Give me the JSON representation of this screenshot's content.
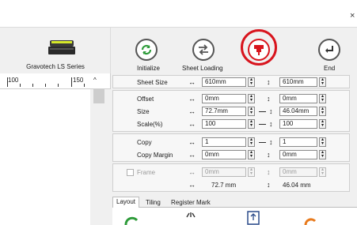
{
  "window": {
    "close_glyph": "×"
  },
  "device": {
    "name": "Gravotech LS Series"
  },
  "toolbar": {
    "initialize": "Initialize",
    "sheet_loading": "Sheet Loading",
    "output": "",
    "end": "End",
    "highlight_color": "#d8141d",
    "initialize_icon_color": "#2e9b3a",
    "output_icon_color": "#d8141d"
  },
  "ruler": {
    "label_100": "100",
    "label_150": "150",
    "caret": "^"
  },
  "fields": {
    "sheet_size": {
      "label": "Sheet Size",
      "width": "610mm",
      "height": "610mm"
    },
    "offset": {
      "label": "Offset",
      "x": "0mm",
      "y": "0mm"
    },
    "size": {
      "label": "Size",
      "width": "72.7mm",
      "height": "46.04mm"
    },
    "scale": {
      "label": "Scale(%)",
      "width": "100",
      "height": "100"
    },
    "copy": {
      "label": "Copy",
      "x": "1",
      "y": "1"
    },
    "copy_margin": {
      "label": "Copy Margin",
      "x": "0mm",
      "y": "0mm"
    },
    "frame": {
      "label": "Frame",
      "x": "0mm",
      "y": "0mm",
      "checked": false
    },
    "totals": {
      "width": "72.7 mm",
      "height": "46.04 mm"
    }
  },
  "tabs": [
    "Layout",
    "Tiling",
    "Register Mark"
  ],
  "layout_icons": [
    "rotate-icon",
    "align-arrows-icon",
    "fit-icon",
    "reset-icon"
  ]
}
